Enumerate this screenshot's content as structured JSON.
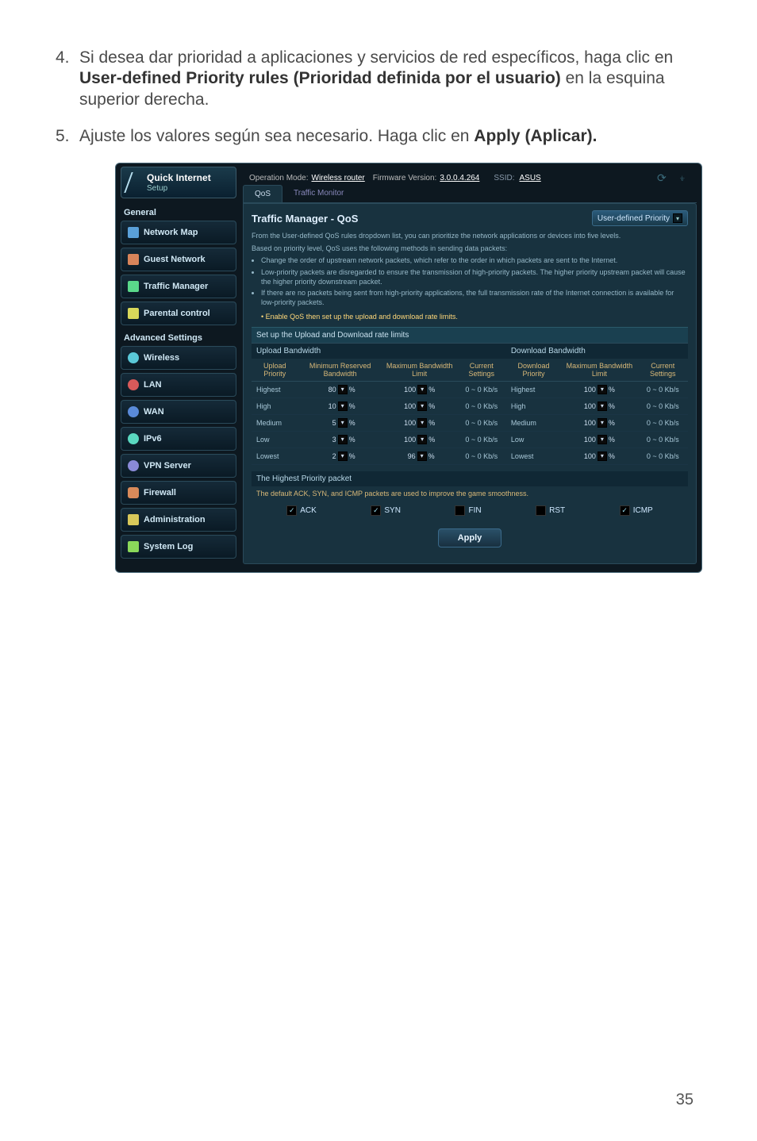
{
  "steps": {
    "s4": {
      "num": "4.",
      "pre": "Si desea dar prioridad a aplicaciones y servicios de red específicos, haga clic en ",
      "bold": "User-defined Priority rules (Prioridad definida por el usuario)",
      "post": " en la esquina superior derecha."
    },
    "s5": {
      "num": "5.",
      "pre": "Ajuste los valores según sea necesario. Haga clic en ",
      "bold": "Apply (Aplicar)."
    }
  },
  "topbar": {
    "opmode_label": "Operation Mode:",
    "opmode_value": "Wireless router",
    "fw_label": "Firmware Version:",
    "fw_value": "3.0.0.4.264",
    "ssid_label": "SSID:",
    "ssid_value": "ASUS"
  },
  "quick": {
    "title": "Quick Internet",
    "sub": "Setup"
  },
  "nav": {
    "general": "General",
    "netmap": "Network Map",
    "guest": "Guest Network",
    "traffic": "Traffic Manager",
    "parental": "Parental control",
    "adv": "Advanced Settings",
    "wireless": "Wireless",
    "lan": "LAN",
    "wan": "WAN",
    "ipv6": "IPv6",
    "vpn": "VPN Server",
    "firewall": "Firewall",
    "admin": "Administration",
    "syslog": "System Log"
  },
  "tabs": {
    "qos": "QoS",
    "monitor": "Traffic Monitor"
  },
  "panel": {
    "title": "Traffic Manager - QoS",
    "userdef": "User-defined Priority",
    "desc1": "From the User-defined QoS rules dropdown list, you can prioritize the network applications or devices into five levels.",
    "desc2": "Based on priority level, QoS uses the following methods in sending data packets:",
    "b1": "Change the order of upstream network packets, which refer to the order in which packets are sent to the Internet.",
    "b2": "Low-priority packets are disregarded to ensure the transmission of high-priority packets. The higher priority upstream packet will cause the higher priority downstream packet.",
    "b3": "If there are no packets being sent from high-priority applications, the full transmission rate of the Internet connection is available for low-priority packets.",
    "enable": "Enable QoS then set up the upload and download rate limits."
  },
  "subhdr": "Set up the Upload and Download rate limits",
  "tblhdr": {
    "up": "Upload Bandwidth",
    "down": "Download Bandwidth"
  },
  "cols": {
    "up_c1": "Upload Priority",
    "up_c2": "Minimum Reserved Bandwidth",
    "up_c3": "Maximum Bandwidth Limit",
    "up_c4": "Current Settings",
    "dn_c1": "Download Priority",
    "dn_c2": "Maximum Bandwidth Limit",
    "dn_c3": "Current Settings"
  },
  "prio": {
    "r1": "Highest",
    "r2": "High",
    "r3": "Medium",
    "r4": "Low",
    "r5": "Lowest"
  },
  "chart_data": {
    "type": "table",
    "upload": {
      "columns": [
        "Upload Priority",
        "Minimum Reserved Bandwidth",
        "Maximum Bandwidth Limit",
        "Current Settings"
      ],
      "rows": [
        {
          "priority": "Highest",
          "min": "80",
          "max": "100",
          "current": "0 ~ 0 Kb/s"
        },
        {
          "priority": "High",
          "min": "10",
          "max": "100",
          "current": "0 ~ 0 Kb/s"
        },
        {
          "priority": "Medium",
          "min": "5",
          "max": "100",
          "current": "0 ~ 0 Kb/s"
        },
        {
          "priority": "Low",
          "min": "3",
          "max": "100",
          "current": "0 ~ 0 Kb/s"
        },
        {
          "priority": "Lowest",
          "min": "2",
          "max": "96",
          "current": "0 ~ 0 Kb/s"
        }
      ]
    },
    "download": {
      "columns": [
        "Download Priority",
        "Maximum Bandwidth Limit",
        "Current Settings"
      ],
      "rows": [
        {
          "priority": "Highest",
          "max": "100",
          "current": "0 ~ 0 Kb/s"
        },
        {
          "priority": "High",
          "max": "100",
          "current": "0 ~ 0 Kb/s"
        },
        {
          "priority": "Medium",
          "max": "100",
          "current": "0 ~ 0 Kb/s"
        },
        {
          "priority": "Low",
          "max": "100",
          "current": "0 ~ 0 Kb/s"
        },
        {
          "priority": "Lowest",
          "max": "100",
          "current": "0 ~ 0 Kb/s"
        }
      ]
    }
  },
  "hpp": {
    "hdr": "The Highest Priority packet",
    "desc": "The default ACK, SYN, and ICMP packets are used to improve the game smoothness.",
    "c1": "ACK",
    "c2": "SYN",
    "c3": "FIN",
    "c4": "RST",
    "c5": "ICMP"
  },
  "apply": "Apply",
  "pagenum": "35"
}
